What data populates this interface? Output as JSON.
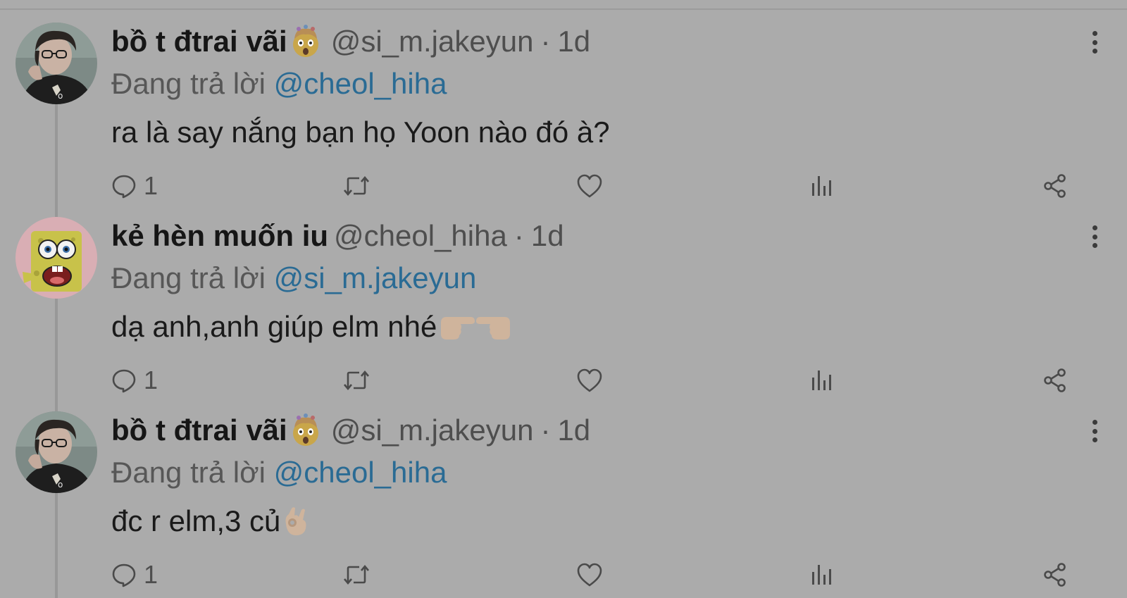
{
  "colors": {
    "background": "#ababab",
    "link": "#2a6b94",
    "secondary_text": "#4e4e4e"
  },
  "tweets": [
    {
      "display_name": "bồ t đtrai vãi",
      "name_emoji": "exploding-head-emoji",
      "handle": "@si_m.jakeyun",
      "separator": "·",
      "time": "1d",
      "reply_prefix": "Đang trả lời",
      "reply_to": "@cheol_hiha",
      "text": "ra là say nắng bạn họ Yoon nào đó à?",
      "reply_count": "1",
      "avatar": "person-glasses-avatar"
    },
    {
      "display_name": "kẻ hèn muốn iu",
      "handle": "@cheol_hiha",
      "separator": "·",
      "time": "1d",
      "reply_prefix": "Đang trả lời",
      "reply_to": "@si_m.jakeyun",
      "text": "dạ anh,anh giúp elm nhé",
      "text_emoji": "pointing-fingers-emoji",
      "reply_count": "1",
      "avatar": "spongebob-avatar"
    },
    {
      "display_name": "bồ t đtrai vãi",
      "name_emoji": "exploding-head-emoji",
      "handle": "@si_m.jakeyun",
      "separator": "·",
      "time": "1d",
      "reply_prefix": "Đang trả lời",
      "reply_to": "@cheol_hiha",
      "text": "đc r elm,3 củ",
      "text_emoji": "ok-hand-emoji",
      "reply_count": "1",
      "avatar": "person-glasses-avatar"
    }
  ],
  "action_icons": [
    "reply-icon",
    "retweet-icon",
    "like-icon",
    "views-icon",
    "share-icon"
  ]
}
